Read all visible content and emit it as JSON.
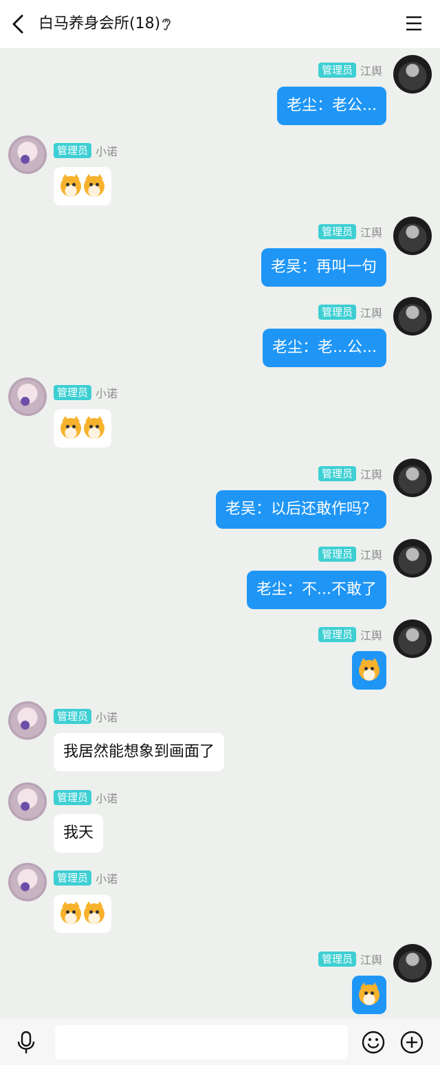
{
  "header": {
    "title": "白马养身会所(18)",
    "back_icon": "chevron-left-icon",
    "ear_icon": "ear-icon",
    "menu_icon": "menu-icon"
  },
  "messages": [
    {
      "side": "right",
      "badge": "管理员",
      "name": "江舆",
      "text": "老尘：老公..."
    },
    {
      "side": "left",
      "badge": "管理员",
      "name": "小诺",
      "emoji_count": 2
    },
    {
      "side": "right",
      "badge": "管理员",
      "name": "江舆",
      "text": "老吴：再叫一句"
    },
    {
      "side": "right",
      "badge": "管理员",
      "name": "江舆",
      "text": "老尘：老...公..."
    },
    {
      "side": "left",
      "badge": "管理员",
      "name": "小诺",
      "emoji_count": 2
    },
    {
      "side": "right",
      "badge": "管理员",
      "name": "江舆",
      "text": "老吴：以后还敢作吗？"
    },
    {
      "side": "right",
      "badge": "管理员",
      "name": "江舆",
      "text": "老尘：不...不敢了"
    },
    {
      "side": "right",
      "badge": "管理员",
      "name": "江舆",
      "emoji_count": 1
    },
    {
      "side": "left",
      "badge": "管理员",
      "name": "小诺",
      "text": "我居然能想象到画面了"
    },
    {
      "side": "left",
      "badge": "管理员",
      "name": "小诺",
      "text": "我天"
    },
    {
      "side": "left",
      "badge": "管理员",
      "name": "小诺",
      "emoji_count": 2
    },
    {
      "side": "right",
      "badge": "管理员",
      "name": "江舆",
      "emoji_count": 1
    }
  ],
  "composer": {
    "input_value": "",
    "mic_icon": "microphone-icon",
    "emoji_icon": "smiley-icon",
    "plus_icon": "plus-circle-icon"
  },
  "colors": {
    "outgoing_bubble": "#1f96f6",
    "incoming_bubble": "#ffffff",
    "badge": "#3ecfd3",
    "background": "#edf0ed"
  }
}
